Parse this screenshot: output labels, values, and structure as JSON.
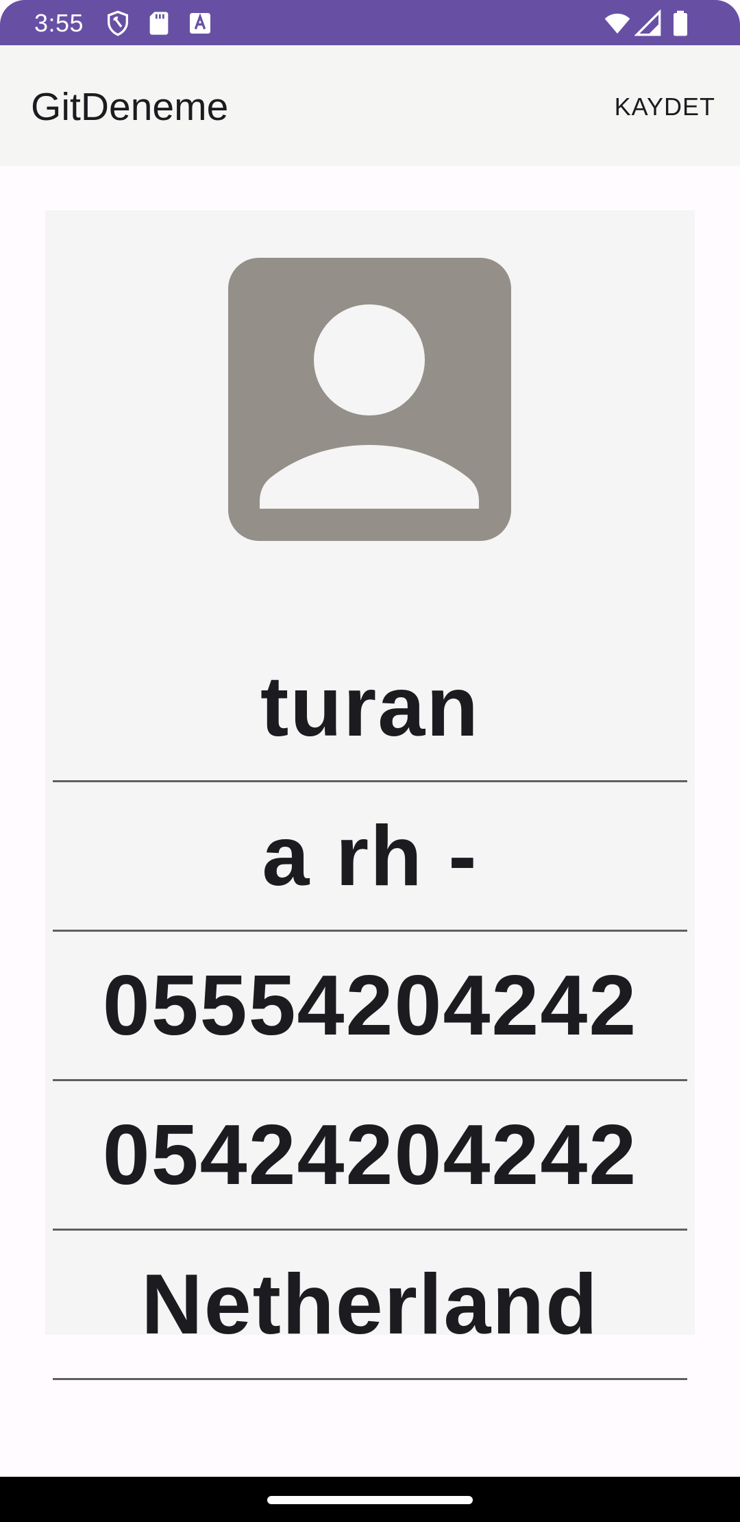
{
  "status_bar": {
    "time": "3:55",
    "icons": [
      "shield-icon",
      "sd-card-icon",
      "text-a-icon",
      "wifi-icon",
      "signal-icon",
      "battery-icon"
    ],
    "background": "#6750a4"
  },
  "app_bar": {
    "title": "GitDeneme",
    "save_label": "KAYDET"
  },
  "profile": {
    "avatar_icon": "person-placeholder-icon",
    "fields": [
      {
        "value": "turan"
      },
      {
        "value": "a rh -"
      },
      {
        "value": "05554204242"
      },
      {
        "value": "05424204242"
      },
      {
        "value": "Netherland"
      }
    ]
  },
  "colors": {
    "accent": "#6750a4",
    "avatar": "#948f89",
    "text": "#1c1b1f"
  }
}
